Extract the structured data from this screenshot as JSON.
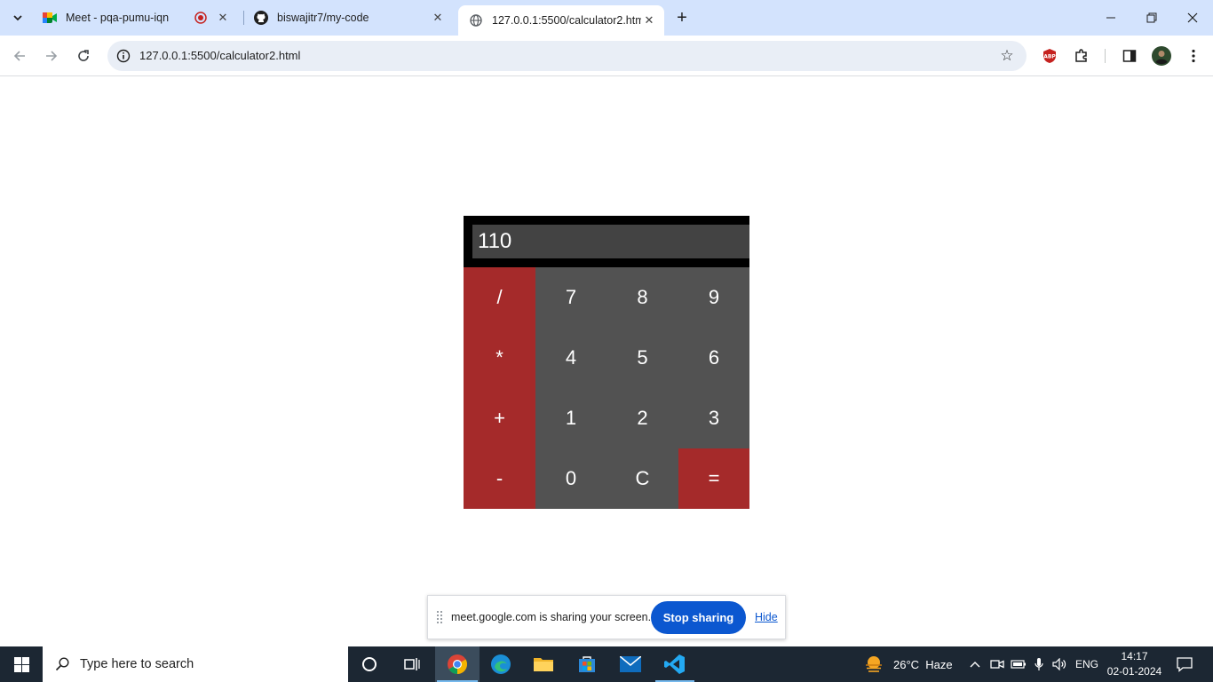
{
  "browser": {
    "tabs": [
      {
        "title": "Meet - pqa-pumu-iqn",
        "active": false
      },
      {
        "title": "biswajitr7/my-code",
        "active": false
      },
      {
        "title": "127.0.0.1:5500/calculator2.html",
        "active": true
      }
    ],
    "url": "127.0.0.1:5500/calculator2.html"
  },
  "calculator": {
    "display": "110",
    "keys": [
      {
        "label": "/",
        "type": "op"
      },
      {
        "label": "7",
        "type": "num"
      },
      {
        "label": "8",
        "type": "num"
      },
      {
        "label": "9",
        "type": "num"
      },
      {
        "label": "*",
        "type": "op"
      },
      {
        "label": "4",
        "type": "num"
      },
      {
        "label": "5",
        "type": "num"
      },
      {
        "label": "6",
        "type": "num"
      },
      {
        "label": "+",
        "type": "op"
      },
      {
        "label": "1",
        "type": "num"
      },
      {
        "label": "2",
        "type": "num"
      },
      {
        "label": "3",
        "type": "num"
      },
      {
        "label": "-",
        "type": "op"
      },
      {
        "label": "0",
        "type": "num"
      },
      {
        "label": "C",
        "type": "num"
      },
      {
        "label": "=",
        "type": "op"
      }
    ],
    "colors": {
      "operator": "#a52a2a",
      "number": "#525252",
      "display": "#434343"
    }
  },
  "share_bar": {
    "message": "meet.google.com is sharing your screen.",
    "stop_label": "Stop sharing",
    "hide_label": "Hide"
  },
  "taskbar": {
    "search_placeholder": "Type here to search",
    "weather": "26°C  Haze",
    "language": "ENG",
    "time": "14:17",
    "date": "02-01-2024"
  }
}
